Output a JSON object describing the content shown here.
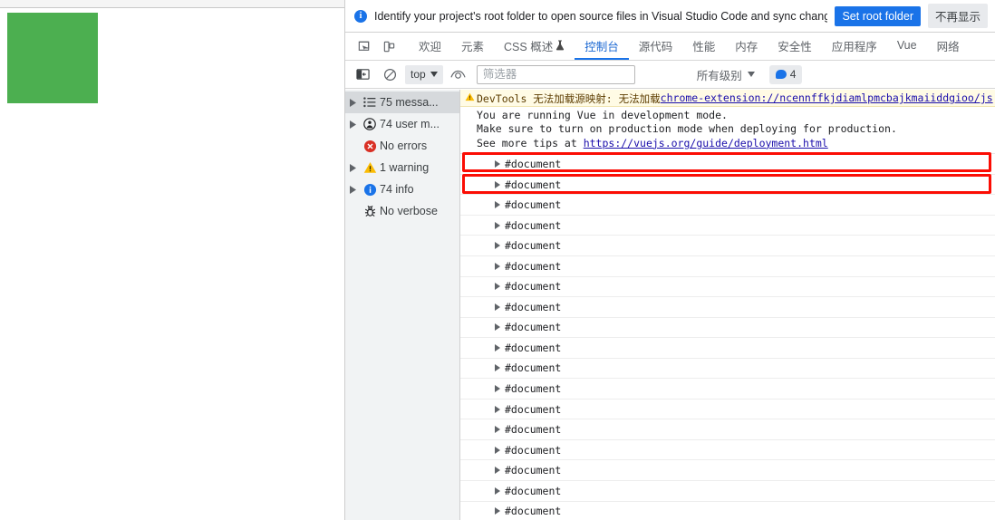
{
  "page": {
    "green_block_color": "#4caf50"
  },
  "infobar": {
    "icon": "info-icon",
    "message": "Identify your project's root folder to open source files in Visual Studio Code and sync changes.",
    "primary_button": "Set root folder",
    "secondary_button": "不再显示",
    "primary_color": "#1a73e8"
  },
  "tabbar": {
    "icons": [
      "inspect-element-icon",
      "device-toolbar-icon"
    ],
    "tabs": [
      {
        "label": "欢迎",
        "active": false
      },
      {
        "label": "元素",
        "active": false
      },
      {
        "label": "CSS 概述",
        "active": false,
        "badge_icon": "flask-icon"
      },
      {
        "label": "控制台",
        "active": true
      },
      {
        "label": "源代码",
        "active": false
      },
      {
        "label": "性能",
        "active": false
      },
      {
        "label": "内存",
        "active": false
      },
      {
        "label": "安全性",
        "active": false
      },
      {
        "label": "应用程序",
        "active": false
      },
      {
        "label": "Vue",
        "active": false
      },
      {
        "label": "网络",
        "active": false
      }
    ],
    "active_color": "#1a73e8"
  },
  "console_toolbar": {
    "sidebar_toggle_icon": "console-sidebar-icon",
    "clear_icon": "clear-console-icon",
    "context_value": "top",
    "eye_icon": "live-expression-eye-icon",
    "filter_placeholder": "筛选器",
    "filter_value": "",
    "level_value": "所有级别",
    "issues_count": "4",
    "issues_icon": "speech-bubble-icon"
  },
  "sidebar": {
    "items": [
      {
        "label": "75 messa...",
        "icon": "list-icon",
        "expandable": true,
        "selected": true
      },
      {
        "label": "74 user m...",
        "icon": "user-message-icon",
        "expandable": true,
        "selected": false
      },
      {
        "label": "No errors",
        "icon": "error-icon",
        "expandable": false,
        "selected": false
      },
      {
        "label": "1 warning",
        "icon": "warning-icon",
        "expandable": true,
        "selected": false
      },
      {
        "label": "74 info",
        "icon": "info-circle-icon",
        "expandable": true,
        "selected": false
      },
      {
        "label": "No verbose",
        "icon": "bug-icon",
        "expandable": false,
        "selected": false
      }
    ]
  },
  "console": {
    "warning_row": {
      "icon": "warning-triangle-icon",
      "text": "DevTools 无法加载源映射:  无法加载",
      "link": "chrome-extension://ncennffkjdiamlpmcbajkmaiiddgioo/js"
    },
    "vue_block": {
      "line1": "You are running Vue in development mode.",
      "line2": "Make sure to turn on production mode when deploying for production.",
      "line3_prefix": "See more tips at ",
      "line3_link": "https://vuejs.org/guide/deployment.html"
    },
    "document_rows": [
      "#document",
      "#document",
      "#document",
      "#document",
      "#document",
      "#document",
      "#document",
      "#document",
      "#document",
      "#document",
      "#document",
      "#document",
      "#document",
      "#document",
      "#document",
      "#document",
      "#document",
      "#document"
    ],
    "annotation_color": "#fb0d04",
    "annotated_row_indices": [
      0,
      1
    ]
  }
}
